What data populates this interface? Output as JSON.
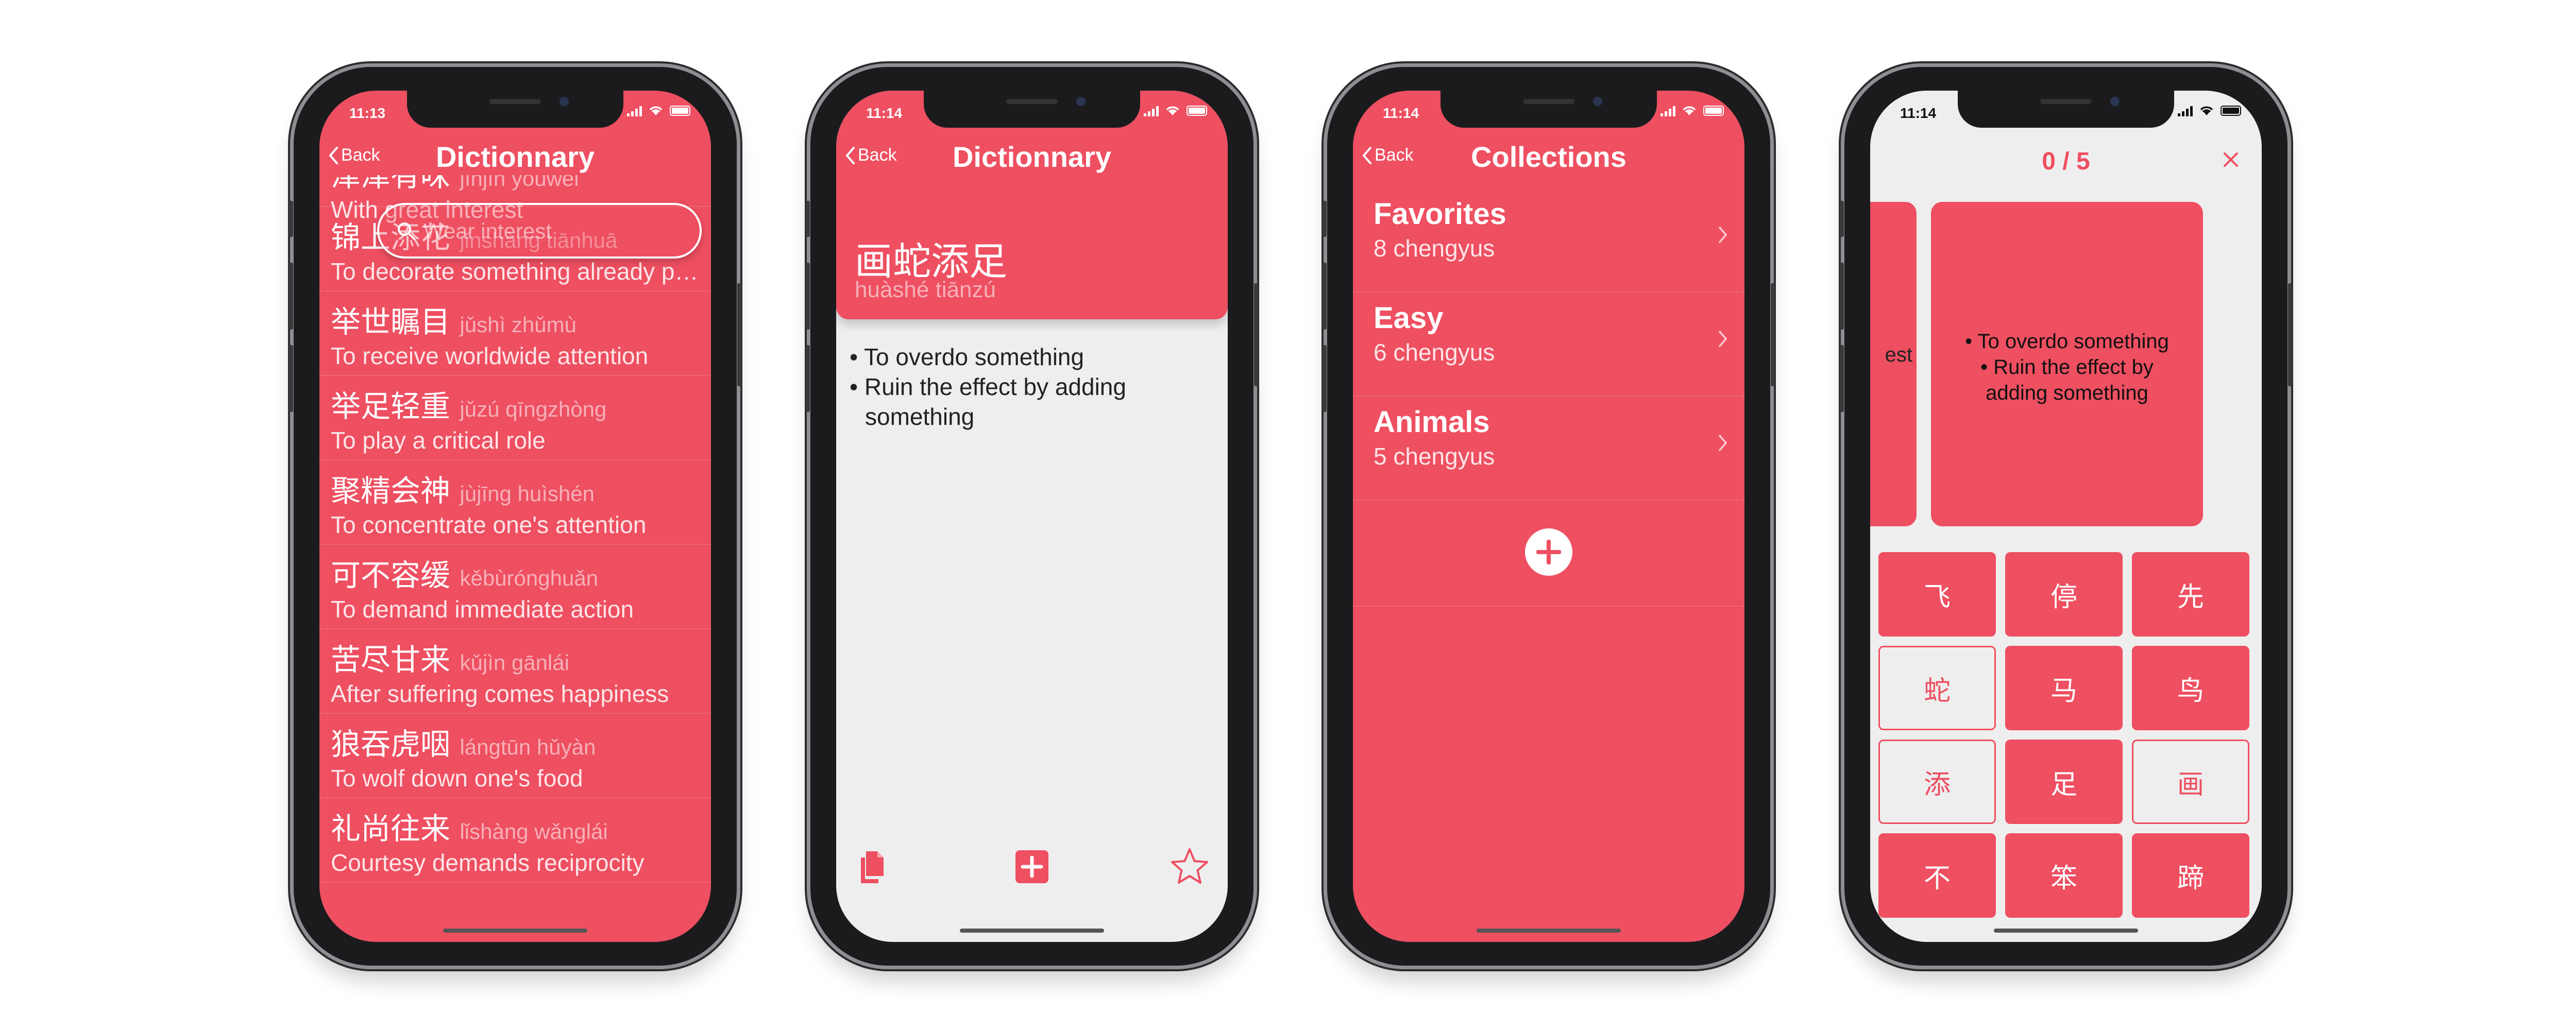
{
  "status_times": [
    "11:13",
    "11:14",
    "11:14",
    "11:14"
  ],
  "accent_color": "#ee4f61",
  "screen1": {
    "back_label": "Back",
    "title": "Dictionnary",
    "search_placeholder": "Wear interest",
    "entries": [
      {
        "cn": "津津有味",
        "pinyin": "jīnjīn yǒuwèi",
        "en": "With great interest"
      },
      {
        "cn": "锦上添花",
        "pinyin": "jǐnshàng tiānhuā",
        "en": "To decorate something already pretty"
      },
      {
        "cn": "举世瞩目",
        "pinyin": "jǔshì zhǔmù",
        "en": "To receive worldwide attention"
      },
      {
        "cn": "举足轻重",
        "pinyin": "jǔzú qīngzhòng",
        "en": "To play a critical role"
      },
      {
        "cn": "聚精会神",
        "pinyin": "jùjīng huìshén",
        "en": "To concentrate one's attention"
      },
      {
        "cn": "可不容缓",
        "pinyin": "kěbùrónghuǎn",
        "en": "To demand immediate action"
      },
      {
        "cn": "苦尽甘来",
        "pinyin": "kǔjìn gānlái",
        "en": "After suffering comes happiness"
      },
      {
        "cn": "狼吞虎咽",
        "pinyin": "lángtūn hǔyàn",
        "en": "To wolf down one's food"
      },
      {
        "cn": "礼尚往来",
        "pinyin": "lǐshàng wǎnglái",
        "en": "Courtesy demands reciprocity"
      }
    ]
  },
  "screen2": {
    "back_label": "Back",
    "title": "Dictionnary",
    "cn": "画蛇添足",
    "pinyin": "huàshé tiānzú",
    "definitions": [
      "• To overdo something",
      "• Ruin the effect by adding something"
    ],
    "toolbar_icons": [
      "copy-icon",
      "add-square-icon",
      "star-icon"
    ]
  },
  "screen3": {
    "back_label": "Back",
    "title": "Collections",
    "collections": [
      {
        "name": "Favorites",
        "count": "8 chengyus"
      },
      {
        "name": "Easy",
        "count": "6 chengyus"
      },
      {
        "name": "Animals",
        "count": "5 chengyus"
      }
    ]
  },
  "screen4": {
    "progress": "0 / 5",
    "peek_text": "est",
    "card_lines": [
      "• To overdo something",
      "• Ruin the effect by",
      "adding something"
    ],
    "tiles": [
      "飞",
      "停",
      "先",
      "蛇",
      "马",
      "鸟",
      "添",
      "足",
      "画",
      "不",
      "笨",
      "蹄"
    ],
    "used_tiles": [
      3,
      6,
      8
    ]
  }
}
